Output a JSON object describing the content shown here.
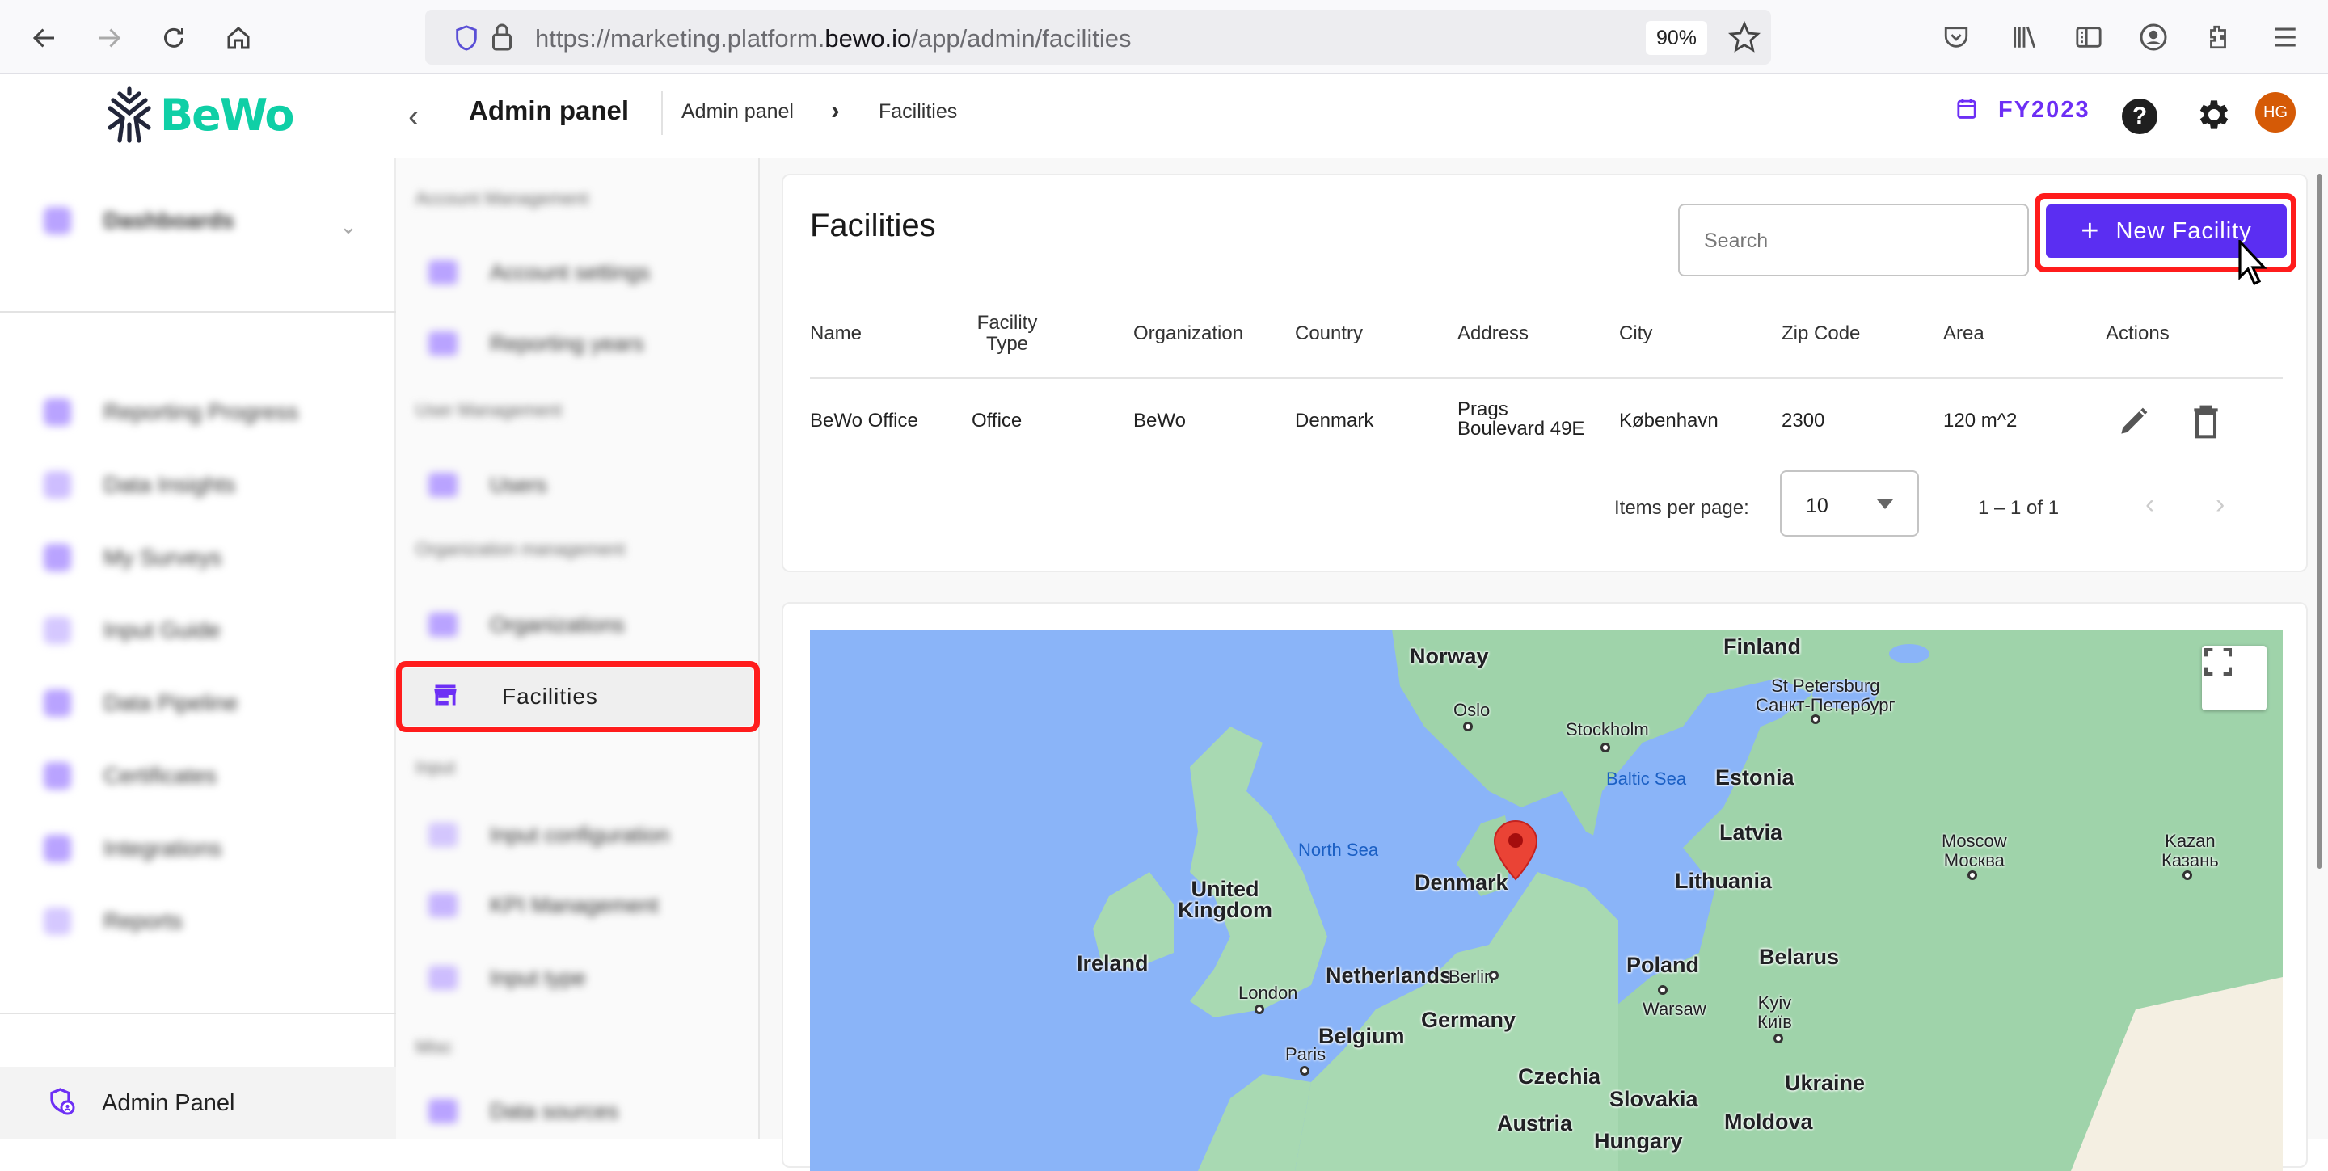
{
  "browser": {
    "url_prefix": "https://marketing.platform.",
    "url_host": "bewo.io",
    "url_path": "/app/admin/facilities",
    "zoom": "90%",
    "icons": [
      "back-icon",
      "forward-icon",
      "reload-icon",
      "home-icon",
      "shield-icon",
      "lock-icon",
      "bookmark-star-icon",
      "pocket-icon",
      "library-icon",
      "reader-view-icon",
      "account-icon",
      "extensions-icon",
      "menu-icon"
    ]
  },
  "header": {
    "logo_text": "BeWo",
    "title": "Admin panel",
    "breadcrumb": [
      "Admin panel",
      "Facilities"
    ],
    "fiscal_year": "FY2023",
    "avatar_initials": "HG",
    "colors": {
      "brand": "#0fcfa6",
      "accent": "#5b2ef2",
      "avatar": "#d55a06"
    }
  },
  "sidebar": {
    "top_item": "Dashboards",
    "items": [
      {
        "label": "Reporting Progress",
        "icon": "progress-icon"
      },
      {
        "label": "Data Insights",
        "icon": "chart-line-icon"
      },
      {
        "label": "My Surveys",
        "icon": "survey-icon"
      },
      {
        "label": "Input Guide",
        "icon": "guide-icon"
      },
      {
        "label": "Data Pipeline",
        "icon": "pipeline-icon"
      },
      {
        "label": "Certificates",
        "icon": "certificate-icon"
      },
      {
        "label": "Integrations",
        "icon": "integrations-icon"
      },
      {
        "label": "Reports",
        "icon": "reports-icon"
      }
    ],
    "bottom_item": "Admin Panel"
  },
  "subnav": {
    "sections": [
      {
        "title": "Account Management",
        "items": [
          "Account settings",
          "Reporting years"
        ]
      },
      {
        "title": "User Management",
        "items": [
          "Users"
        ]
      },
      {
        "title": "Organization management",
        "items": [
          "Organizations",
          "Facilities"
        ]
      },
      {
        "title": "Input",
        "items": [
          "Input configuration",
          "KPI Management",
          "Input type"
        ]
      },
      {
        "title": "Misc",
        "items": [
          "Data sources"
        ]
      }
    ],
    "active": "Facilities"
  },
  "facilities": {
    "title": "Facilities",
    "search_placeholder": "Search",
    "search_value": "",
    "new_button": "New Facility",
    "columns": [
      "Name",
      "Facility Type",
      "Organization",
      "Country",
      "Address",
      "City",
      "Zip Code",
      "Area",
      "Actions"
    ],
    "columns_wrapped": {
      "facility_type_1": "Facility",
      "facility_type_2": "Type"
    },
    "rows": [
      {
        "name": "BeWo Office",
        "type": "Office",
        "organization": "BeWo",
        "country": "Denmark",
        "address_1": "Prags",
        "address_2": "Boulevard 49E",
        "city": "København",
        "zip": "2300",
        "area": "120 m^2"
      }
    ],
    "pagination": {
      "items_per_page_label": "Items per page:",
      "items_per_page": "10",
      "range": "1 – 1 of 1"
    }
  },
  "map": {
    "countries": [
      "Norway",
      "Finland",
      "Estonia",
      "Latvia",
      "Lithuania",
      "Denmark",
      "United Kingdom",
      "Ireland",
      "Netherlands",
      "Germany",
      "Poland",
      "Belarus",
      "Belgium",
      "Czechia",
      "Slovakia",
      "Ukraine",
      "Austria",
      "Moldova",
      "Hungary"
    ],
    "labels": {
      "norway": "Norway",
      "finland": "Finland",
      "estonia": "Estonia",
      "latvia": "Latvia",
      "lithuania": "Lithuania",
      "denmark": "Denmark",
      "uk_1": "United",
      "uk_2": "Kingdom",
      "ireland": "Ireland",
      "netherlands": "Netherlands",
      "germany": "Germany",
      "poland": "Poland",
      "belarus": "Belarus",
      "belgium": "Belgium",
      "czechia": "Czechia",
      "slovakia": "Slovakia",
      "ukraine": "Ukraine",
      "austria": "Austria",
      "moldova": "Moldova",
      "hungary": "Hungary",
      "oslo": "Oslo",
      "stockholm": "Stockholm",
      "stpete_1": "St Petersburg",
      "stpete_2": "Санкт-Петербург",
      "moscow_1": "Moscow",
      "moscow_2": "Москва",
      "kazan_1": "Kazan",
      "kazan_2": "Казань",
      "london": "London",
      "berlin": "Berlin",
      "warsaw": "Warsaw",
      "kyiv_1": "Kyiv",
      "kyiv_2": "Київ",
      "paris": "Paris",
      "north_sea": "North Sea",
      "baltic_sea": "Baltic Sea"
    },
    "marker": "København"
  }
}
